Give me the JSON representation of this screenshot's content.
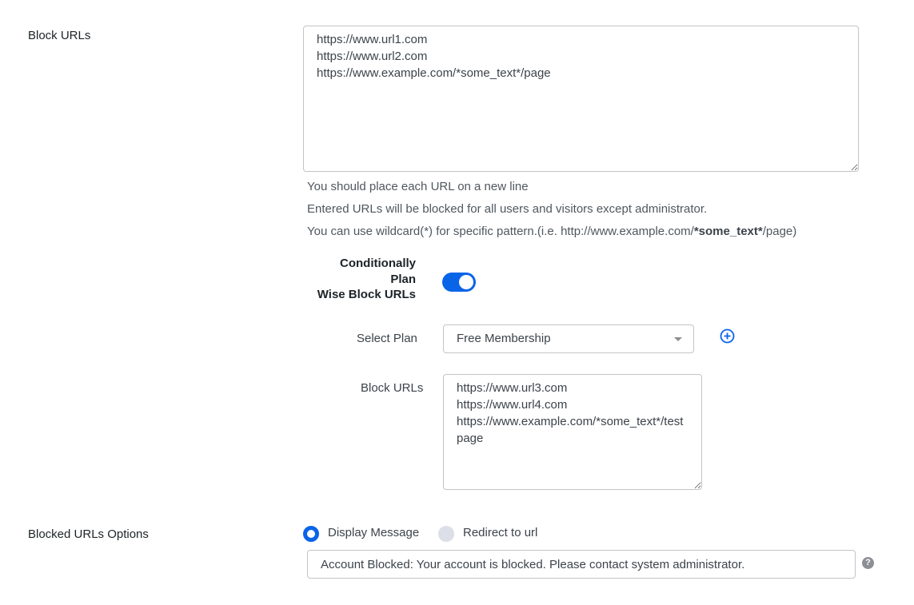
{
  "block_urls": {
    "label": "Block URLs",
    "value": "https://www.url1.com\nhttps://www.url2.com\nhttps://www.example.com/*some_text*/page",
    "hints": [
      "You should place each URL on a new line",
      "Entered URLs will be blocked for all users and visitors except administrator."
    ],
    "wildcard_hint": {
      "prefix": "You can use wildcard(*) for specific pattern.(i.e. http://www.example.com/",
      "bold": "*some_text*",
      "suffix": "/page)"
    }
  },
  "conditional": {
    "label_lines": [
      "Conditionally",
      "Plan",
      "Wise Block URLs"
    ],
    "toggle_on": true
  },
  "plan": {
    "select_label": "Select Plan",
    "selected": "Free Membership",
    "add_icon": "plus-circle-icon",
    "block_label": "Block URLs",
    "block_value": "https://www.url3.com\nhttps://www.url4.com\nhttps://www.example.com/*some_text*/testpage"
  },
  "options": {
    "label": "Blocked URLs Options",
    "radios": [
      {
        "label": "Display Message",
        "checked": true
      },
      {
        "label": "Redirect to url",
        "checked": false
      }
    ],
    "message": "Account Blocked: Your account is blocked. Please contact system administrator.",
    "help_icon": "question-circle-icon"
  },
  "colors": {
    "accent": "#0a64e8",
    "border": "#c3c4c7",
    "radio_off": "#dcdfe8"
  }
}
